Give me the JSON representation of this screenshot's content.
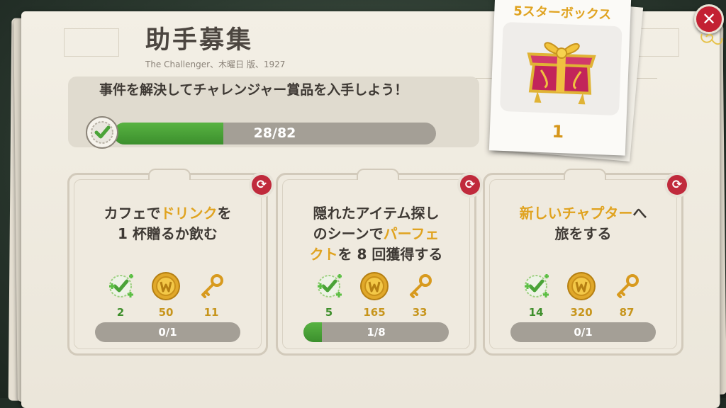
{
  "header": {
    "title": "助手募集",
    "subtitle": "The Challenger、木曜日 版、1927",
    "close_icon": "close-icon"
  },
  "objective": {
    "text": "事件を解決してチャレンジャー賞品を入手しよう！",
    "progress_label": "28/82",
    "progress_value": 28,
    "progress_max": 82
  },
  "prize": {
    "title": "5スターボックス",
    "count": "1",
    "icon": "gift-box-icon"
  },
  "tasks": [
    {
      "text_parts": [
        "カフェで",
        "ドリンク",
        "を\n1 杯贈るか飲む"
      ],
      "highlight_index": 1,
      "rewards": {
        "challenge": "2",
        "coins": "50",
        "keys": "11"
      },
      "progress_label": "0/1",
      "progress_value": 0,
      "progress_max": 1
    },
    {
      "text_parts": [
        "隠れたアイテム探し\nのシーンで",
        "パーフェ\nクト",
        "を 8 回獲得する"
      ],
      "highlight_index": 1,
      "rewards": {
        "challenge": "5",
        "coins": "165",
        "keys": "33"
      },
      "progress_label": "1/8",
      "progress_value": 1,
      "progress_max": 8
    },
    {
      "text_parts": [
        "",
        "新しいチャプター",
        "へ\n旅をする"
      ],
      "highlight_index": 1,
      "rewards": {
        "challenge": "14",
        "coins": "320",
        "keys": "87"
      },
      "progress_label": "0/1",
      "progress_value": 0,
      "progress_max": 1
    }
  ],
  "colors": {
    "progress_green": "#4aa338",
    "highlight_gold": "#e0a320",
    "refresh_red": "#c02a3c"
  }
}
